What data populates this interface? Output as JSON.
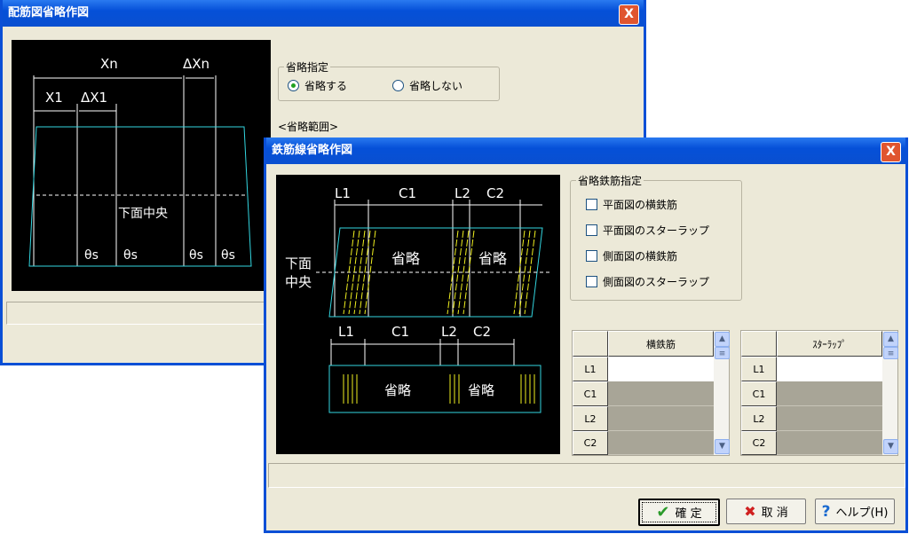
{
  "win1": {
    "title": "配筋図省略作図",
    "close": "X",
    "diagram": {
      "xn": "Xn",
      "dxn": "ΔXn",
      "x1": "X1",
      "dx1": "ΔX1",
      "center": "下面中央",
      "theta": "θs"
    },
    "group": {
      "label": "省略指定",
      "options": [
        {
          "label": "省略する",
          "selected": true
        },
        {
          "label": "省略しない",
          "selected": false
        }
      ]
    },
    "range_label": "<省略範囲>"
  },
  "win2": {
    "title": "鉄筋線省略作図",
    "close": "X",
    "diagram": {
      "l1": "L1",
      "c1": "C1",
      "l2": "L2",
      "c2": "C2",
      "omit": "省略",
      "center1": "下面",
      "center2": "中央"
    },
    "group": {
      "label": "省略鉄筋指定",
      "items": [
        {
          "label": "平面図の横鉄筋",
          "checked": false
        },
        {
          "label": "平面図のスターラップ",
          "checked": false
        },
        {
          "label": "側面図の横鉄筋",
          "checked": false
        },
        {
          "label": "側面図のスターラップ",
          "checked": false
        }
      ]
    },
    "table1": {
      "header": "横鉄筋",
      "rows": [
        "L1",
        "C1",
        "L2",
        "C2"
      ]
    },
    "table2": {
      "header": "ｽﾀｰﾗｯﾌﾟ",
      "rows": [
        "L1",
        "C1",
        "L2",
        "C2"
      ]
    },
    "buttons": {
      "ok": "確 定",
      "cancel": "取 消",
      "help": "ヘルプ(H)"
    }
  },
  "colors": {
    "cyan": "#33d6e0",
    "yellow": "#f0f020",
    "titlebar": "#0550d8"
  }
}
